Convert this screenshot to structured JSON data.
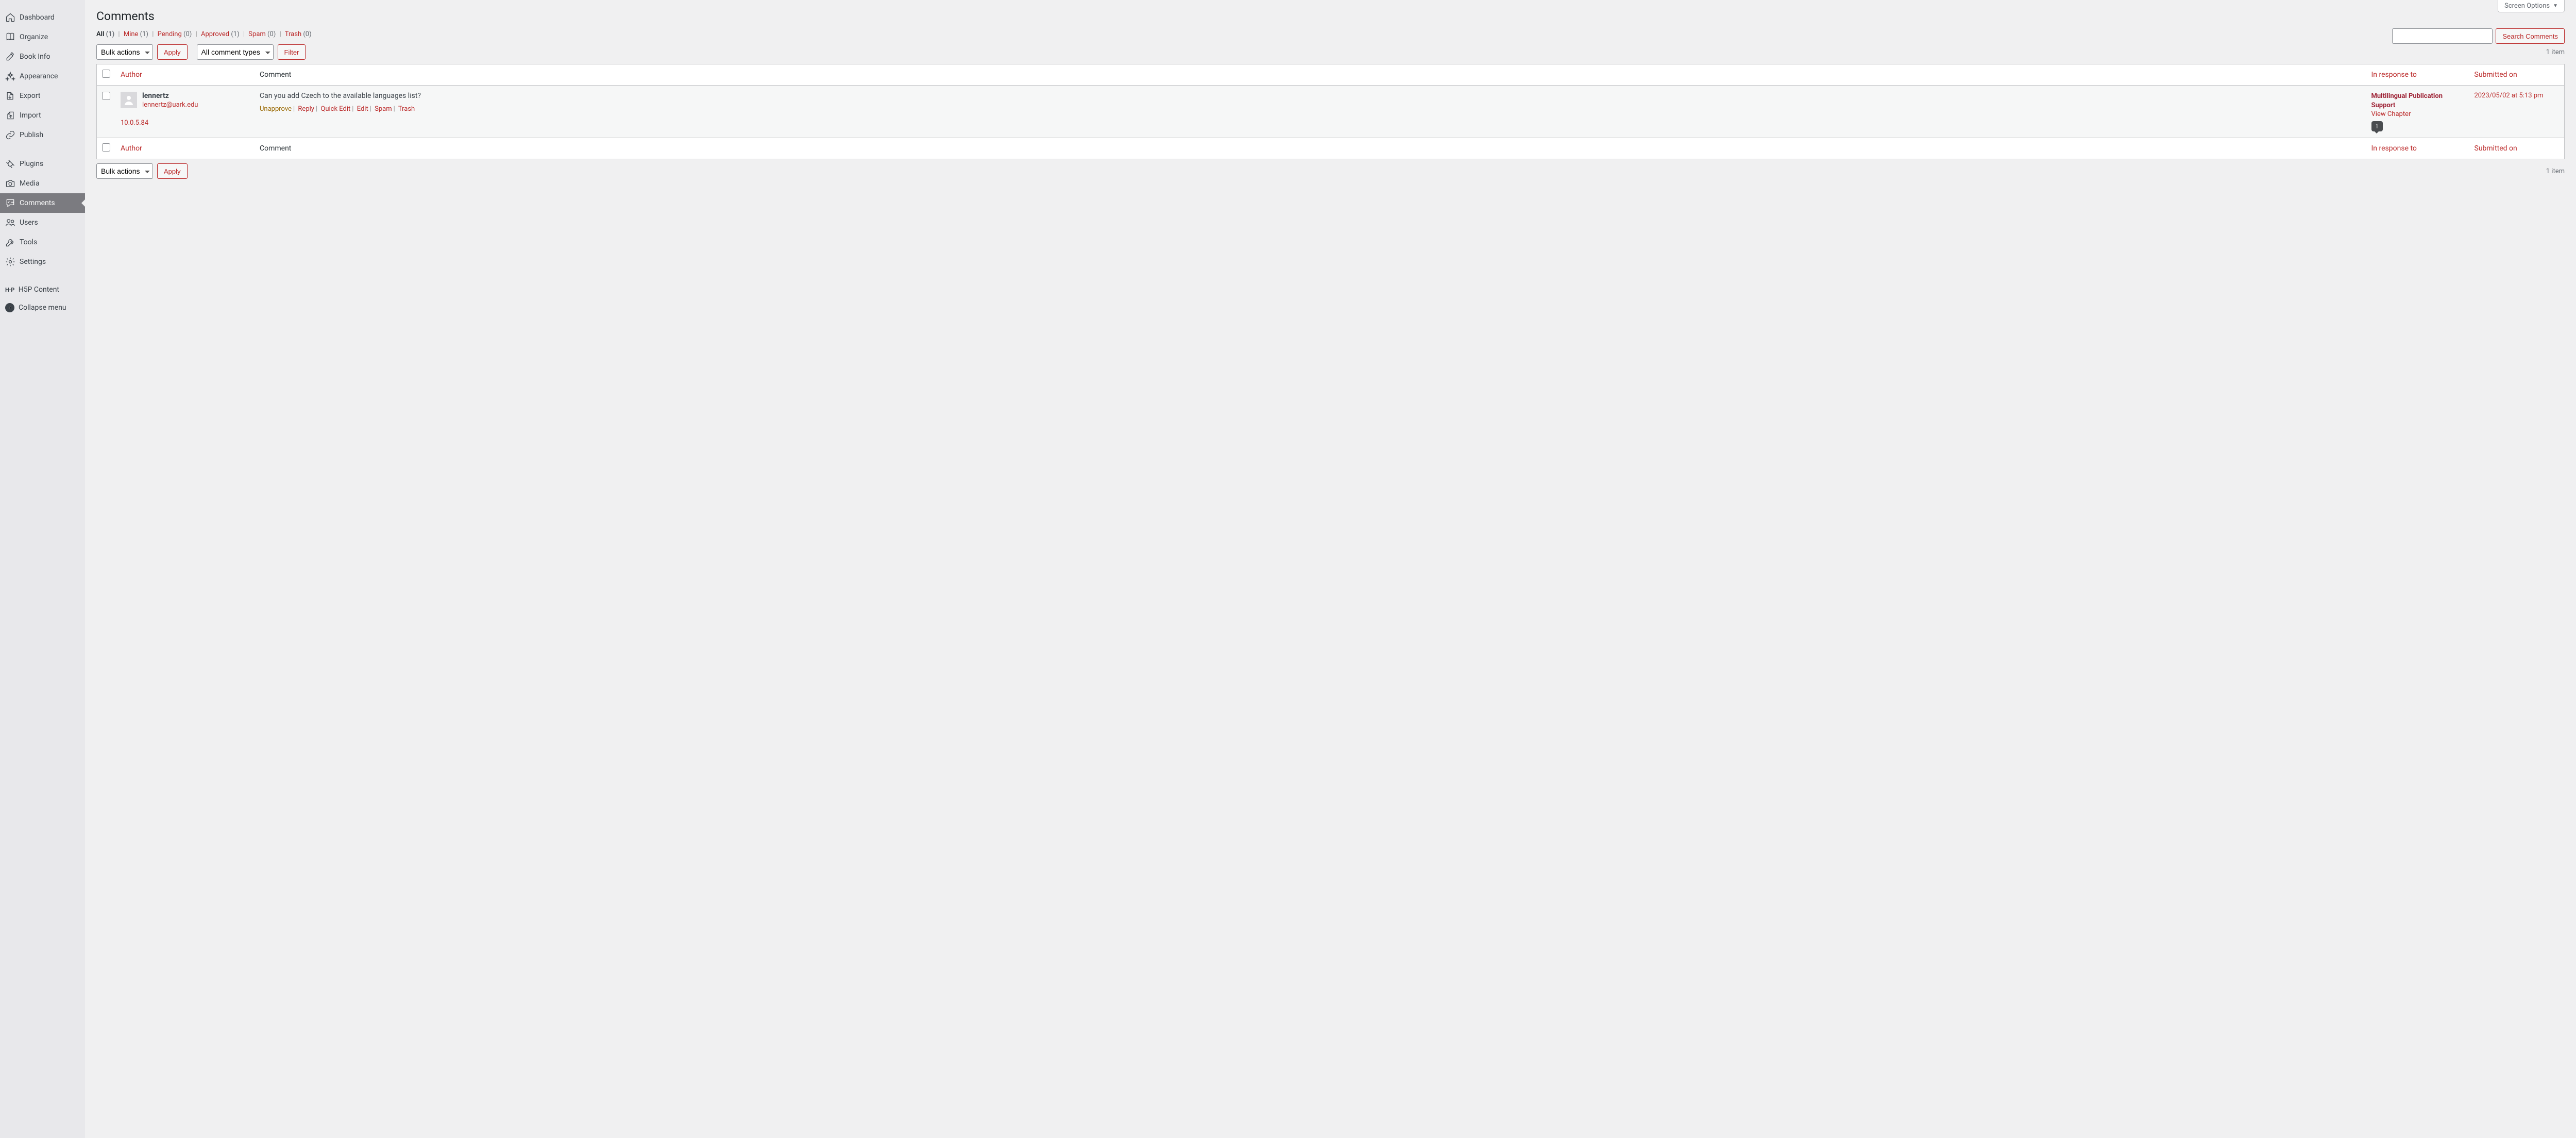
{
  "screen_options": "Screen Options",
  "page_title": "Comments",
  "sidebar": {
    "items": [
      {
        "label": "Dashboard",
        "icon": "home"
      },
      {
        "label": "Organize",
        "icon": "book"
      },
      {
        "label": "Book Info",
        "icon": "edit"
      },
      {
        "label": "Appearance",
        "icon": "sparkle"
      },
      {
        "label": "Export",
        "icon": "export"
      },
      {
        "label": "Import",
        "icon": "import"
      },
      {
        "label": "Publish",
        "icon": "link"
      }
    ],
    "items2": [
      {
        "label": "Plugins",
        "icon": "plug"
      },
      {
        "label": "Media",
        "icon": "camera"
      },
      {
        "label": "Comments",
        "icon": "comment",
        "current": true
      },
      {
        "label": "Users",
        "icon": "users"
      },
      {
        "label": "Tools",
        "icon": "wrench"
      },
      {
        "label": "Settings",
        "icon": "gear"
      }
    ],
    "items3": [
      {
        "label": "H5P Content",
        "icon": "h5p"
      }
    ],
    "collapse": "Collapse menu"
  },
  "filters": {
    "all": {
      "label": "All",
      "count": "(1)"
    },
    "mine": {
      "label": "Mine",
      "count": "(1)"
    },
    "pending": {
      "label": "Pending",
      "count": "(0)"
    },
    "approved": {
      "label": "Approved",
      "count": "(1)"
    },
    "spam": {
      "label": "Spam",
      "count": "(0)"
    },
    "trash": {
      "label": "Trash",
      "count": "(0)"
    }
  },
  "search": {
    "button": "Search Comments"
  },
  "bulk": {
    "label": "Bulk actions",
    "apply": "Apply"
  },
  "type_filter": {
    "label": "All comment types",
    "filter": "Filter"
  },
  "items_count": "1 item",
  "columns": {
    "author": "Author",
    "comment": "Comment",
    "response": "In response to",
    "date": "Submitted on"
  },
  "row": {
    "author_name": "lennertz",
    "author_email": "lennertz@uark.edu",
    "author_ip": "10.0.5.84",
    "text": "Can you add Czech to the available languages list?",
    "actions": {
      "unapprove": "Unapprove",
      "reply": "Reply",
      "quickedit": "Quick Edit",
      "edit": "Edit",
      "spam": "Spam",
      "trash": "Trash"
    },
    "response_title": "Multilingual Publication Support",
    "response_view": "View Chapter",
    "response_count": "1",
    "date": "2023/05/02 at 5:13 pm"
  }
}
